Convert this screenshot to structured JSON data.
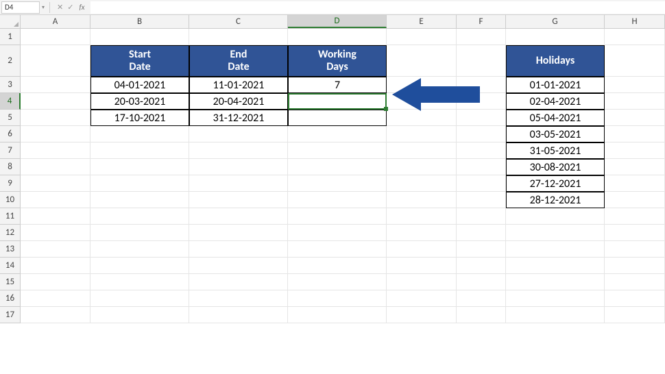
{
  "name_box": "D4",
  "fx_label": "fx",
  "columns": [
    "A",
    "B",
    "C",
    "D",
    "E",
    "F",
    "G",
    "H"
  ],
  "selected_column": "D",
  "selected_row": 4,
  "active_cell": "D4",
  "formula_value": "",
  "main_table": {
    "headers": {
      "start_l1": "Start",
      "start_l2": "Date",
      "end_l1": "End",
      "end_l2": "Date",
      "work_l1": "Working",
      "work_l2": "Days"
    },
    "rows": [
      {
        "start": "04-01-2021",
        "end": "11-01-2021",
        "days": "7"
      },
      {
        "start": "20-03-2021",
        "end": "20-04-2021",
        "days": ""
      },
      {
        "start": "17-10-2021",
        "end": "31-12-2021",
        "days": ""
      }
    ]
  },
  "holidays": {
    "header": "Holidays",
    "values": [
      "01-01-2021",
      "02-04-2021",
      "05-04-2021",
      "03-05-2021",
      "31-05-2021",
      "30-08-2021",
      "27-12-2021",
      "28-12-2021"
    ]
  },
  "arrow_color": "#1f4e9c",
  "header_blue": "#305496",
  "chart_data": {
    "type": "table",
    "tables": [
      {
        "name": "working_days",
        "columns": [
          "Start Date",
          "End Date",
          "Working Days"
        ],
        "rows": [
          [
            "04-01-2021",
            "11-01-2021",
            7
          ],
          [
            "20-03-2021",
            "20-04-2021",
            null
          ],
          [
            "17-10-2021",
            "31-12-2021",
            null
          ]
        ]
      },
      {
        "name": "holidays",
        "columns": [
          "Holidays"
        ],
        "rows": [
          [
            "01-01-2021"
          ],
          [
            "02-04-2021"
          ],
          [
            "05-04-2021"
          ],
          [
            "03-05-2021"
          ],
          [
            "31-05-2021"
          ],
          [
            "30-08-2021"
          ],
          [
            "27-12-2021"
          ],
          [
            "28-12-2021"
          ]
        ]
      }
    ]
  }
}
